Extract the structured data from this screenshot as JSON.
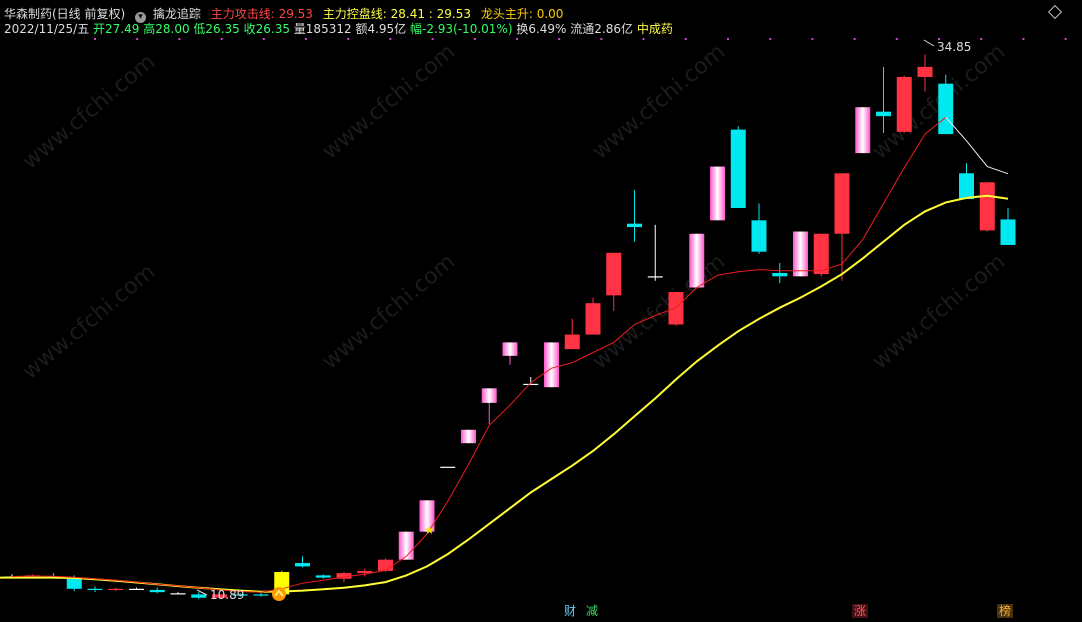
{
  "header": {
    "stock_name": "华森制药(日线 前复权)",
    "indicator_name": "擒龙追踪",
    "attack_line": {
      "label": "主力攻击线:",
      "value": "29.53"
    },
    "control_line": {
      "label": "主力控盘线:",
      "value": "28.41 : 29.53"
    },
    "leader_rise": {
      "label": "龙头主升:",
      "value": "0.00"
    }
  },
  "info": {
    "date": "2022/11/25/五",
    "open": "开27.49",
    "high": "高28.00",
    "low": "低26.35",
    "close": "收26.35",
    "volume": "量185312",
    "amount": "额4.95亿",
    "change": "幅-2.93(-10.01%)",
    "turnover": "换6.49%",
    "float": "流通2.86亿",
    "sector": "中成药"
  },
  "annotations": {
    "high_label": "34.85",
    "low_label": "10.89"
  },
  "markers": [
    {
      "text": "财",
      "color": "#66ccff"
    },
    {
      "text": "减",
      "color": "#33dd66"
    },
    {
      "text": "涨",
      "color": "#ff5555"
    },
    {
      "text": "榜",
      "color": "#ffaa33"
    }
  ],
  "colors": {
    "up": "#ff3344",
    "down": "#00e8f0",
    "bg": "#000000",
    "attack_line": "#ee1c1c",
    "control_line": "#ffff33",
    "leader": "#ffcc00",
    "header_red": "#ff4444",
    "header_yellow": "#ffff44",
    "header_green": "#33ff66"
  },
  "watermark": "www.cfchi.com",
  "chart_data": {
    "type": "candlestick",
    "candles": [
      {
        "style": "flat",
        "o": 11.55,
        "h": 11.65,
        "l": 11.5,
        "c": 11.55
      },
      {
        "style": "up",
        "o": 11.5,
        "h": 11.65,
        "l": 11.45,
        "c": 11.6
      },
      {
        "style": "down",
        "o": 11.55,
        "h": 11.7,
        "l": 11.45,
        "c": 11.5
      },
      {
        "style": "down",
        "o": 11.45,
        "h": 11.6,
        "l": 10.9,
        "c": 11.0
      },
      {
        "style": "down",
        "o": 11.0,
        "h": 11.1,
        "l": 10.85,
        "c": 10.95
      },
      {
        "style": "up",
        "o": 10.95,
        "h": 11.05,
        "l": 10.9,
        "c": 11.0
      },
      {
        "style": "flat",
        "o": 11.0,
        "h": 11.05,
        "l": 10.95,
        "c": 11.0
      },
      {
        "style": "down",
        "o": 10.95,
        "h": 11.05,
        "l": 10.8,
        "c": 10.85
      },
      {
        "style": "flat",
        "o": 10.8,
        "h": 10.85,
        "l": 10.75,
        "c": 10.8
      },
      {
        "style": "down",
        "o": 10.75,
        "h": 10.85,
        "l": 10.55,
        "c": 10.6
      },
      {
        "style": "up",
        "o": 10.6,
        "h": 10.8,
        "l": 10.55,
        "c": 10.75
      },
      {
        "style": "down",
        "o": 10.75,
        "h": 10.8,
        "l": 10.65,
        "c": 10.7
      },
      {
        "style": "down",
        "o": 10.75,
        "h": 10.85,
        "l": 10.65,
        "c": 10.7
      },
      {
        "style": "yellow",
        "o": 10.75,
        "h": 11.8,
        "l": 10.7,
        "c": 11.75
      },
      {
        "style": "down",
        "o": 12.15,
        "h": 12.45,
        "l": 11.95,
        "c": 12.0
      },
      {
        "style": "down",
        "o": 11.6,
        "h": 11.65,
        "l": 11.45,
        "c": 11.5
      },
      {
        "style": "up",
        "o": 11.45,
        "h": 11.75,
        "l": 11.3,
        "c": 11.7
      },
      {
        "style": "up",
        "o": 11.7,
        "h": 11.9,
        "l": 11.55,
        "c": 11.8
      },
      {
        "style": "up",
        "o": 11.8,
        "h": 12.35,
        "l": 11.75,
        "c": 12.3
      },
      {
        "style": "limit",
        "o": 12.3,
        "h": 13.55,
        "l": 12.3,
        "c": 13.55
      },
      {
        "style": "limit",
        "o": 13.55,
        "h": 14.95,
        "l": 13.55,
        "c": 14.95
      },
      {
        "style": "flat",
        "o": 16.45,
        "h": 16.45,
        "l": 16.45,
        "c": 16.45
      },
      {
        "style": "limit",
        "o": 17.5,
        "h": 18.1,
        "l": 17.5,
        "c": 18.1
      },
      {
        "style": "limit",
        "o": 19.3,
        "h": 19.95,
        "l": 18.35,
        "c": 19.95
      },
      {
        "style": "limit",
        "o": 21.4,
        "h": 22.0,
        "l": 21.0,
        "c": 22.0
      },
      {
        "style": "doji",
        "o": 20.15,
        "h": 20.45,
        "l": 20.1,
        "c": 20.15
      },
      {
        "style": "limit",
        "o": 20.0,
        "h": 22.0,
        "l": 20.0,
        "c": 22.0
      },
      {
        "style": "up",
        "o": 21.7,
        "h": 23.05,
        "l": 21.7,
        "c": 22.35
      },
      {
        "style": "up",
        "o": 22.35,
        "h": 24.0,
        "l": 22.35,
        "c": 23.75
      },
      {
        "style": "up",
        "o": 24.1,
        "h": 26.0,
        "l": 23.4,
        "c": 26.0
      },
      {
        "style": "down",
        "o": 27.3,
        "h": 28.8,
        "l": 26.5,
        "c": 27.15
      },
      {
        "style": "doji",
        "o": 24.95,
        "h": 27.25,
        "l": 24.75,
        "c": 24.95
      },
      {
        "style": "up",
        "o": 22.8,
        "h": 24.2,
        "l": 22.75,
        "c": 24.25
      },
      {
        "style": "limit",
        "o": 24.45,
        "h": 26.85,
        "l": 24.45,
        "c": 26.85
      },
      {
        "style": "limit",
        "o": 27.45,
        "h": 29.85,
        "l": 27.45,
        "c": 29.85
      },
      {
        "style": "down",
        "o": 31.5,
        "h": 31.65,
        "l": 28.0,
        "c": 28.0
      },
      {
        "style": "down",
        "o": 27.45,
        "h": 28.2,
        "l": 25.95,
        "c": 26.05
      },
      {
        "style": "down",
        "o": 25.1,
        "h": 25.55,
        "l": 24.65,
        "c": 24.95
      },
      {
        "style": "limit",
        "o": 24.95,
        "h": 26.95,
        "l": 24.95,
        "c": 26.95
      },
      {
        "style": "up",
        "o": 25.05,
        "h": 26.85,
        "l": 24.95,
        "c": 26.85
      },
      {
        "style": "up",
        "o": 26.85,
        "h": 29.55,
        "l": 24.75,
        "c": 29.55
      },
      {
        "style": "limit",
        "o": 30.45,
        "h": 32.5,
        "l": 30.45,
        "c": 32.5
      },
      {
        "style": "down",
        "o": 32.3,
        "h": 34.3,
        "l": 31.35,
        "c": 32.1
      },
      {
        "style": "up",
        "o": 31.4,
        "h": 33.9,
        "l": 31.35,
        "c": 33.85
      },
      {
        "style": "up",
        "o": 33.85,
        "h": 34.85,
        "l": 33.2,
        "c": 34.3
      },
      {
        "style": "down",
        "o": 33.55,
        "h": 33.95,
        "l": 31.3,
        "c": 31.3
      },
      {
        "style": "down",
        "o": 29.55,
        "h": 30.0,
        "l": 28.4,
        "c": 28.4
      },
      {
        "style": "up",
        "o": 27.0,
        "h": 29.15,
        "l": 26.95,
        "c": 29.15
      },
      {
        "style": "down",
        "o": 27.49,
        "h": 28.0,
        "l": 26.35,
        "c": 26.35
      }
    ],
    "attack_line": [
      11.55,
      11.57,
      11.56,
      11.52,
      11.44,
      11.38,
      11.3,
      11.2,
      11.13,
      11.05,
      10.95,
      10.88,
      10.85,
      11.0,
      11.25,
      11.38,
      11.53,
      11.65,
      11.82,
      12.45,
      13.45,
      14.9,
      16.55,
      18.3,
      19.2,
      20.2,
      20.85,
      21.1,
      21.55,
      22.0,
      22.8,
      23.2,
      23.55,
      24.45,
      25.0,
      25.15,
      25.25,
      25.2,
      25.2,
      25.2,
      25.5,
      26.6,
      28.2,
      29.8,
      31.3,
      32.05,
      31.0,
      29.85,
      29.53
    ],
    "control_line": [
      11.5,
      11.5,
      11.5,
      11.48,
      11.43,
      11.36,
      11.28,
      11.2,
      11.12,
      11.05,
      10.98,
      10.92,
      10.87,
      10.88,
      10.92,
      10.98,
      11.05,
      11.15,
      11.3,
      11.6,
      12.0,
      12.55,
      13.2,
      13.9,
      14.6,
      15.3,
      15.9,
      16.5,
      17.15,
      17.9,
      18.7,
      19.5,
      20.35,
      21.15,
      21.85,
      22.5,
      23.05,
      23.55,
      24.0,
      24.5,
      25.05,
      25.75,
      26.5,
      27.25,
      27.85,
      28.25,
      28.45,
      28.55,
      28.41
    ],
    "ylim": [
      10.5,
      35.5
    ]
  }
}
